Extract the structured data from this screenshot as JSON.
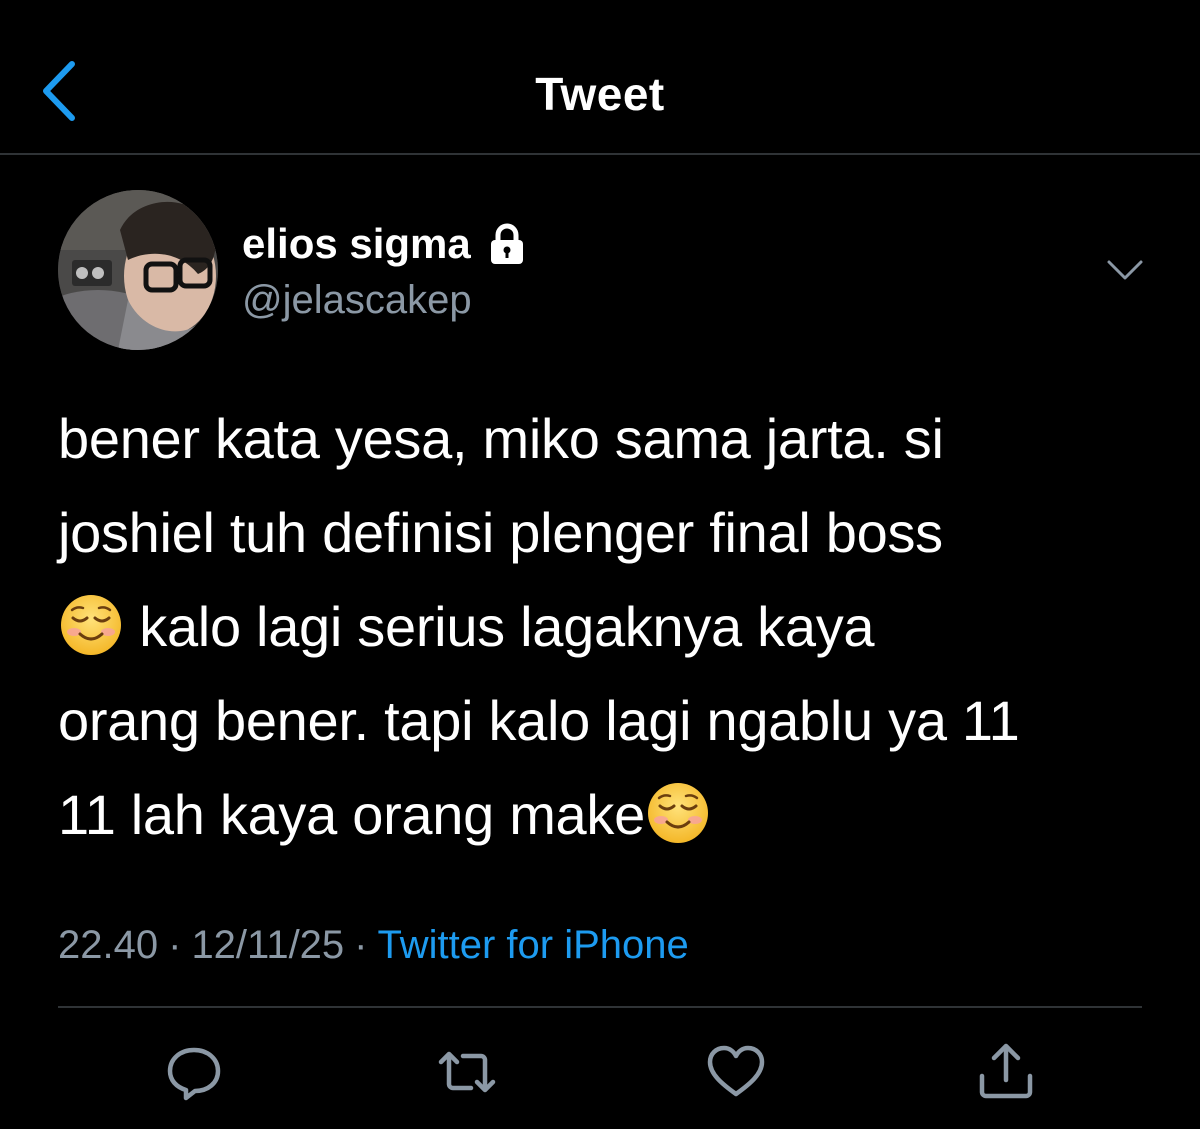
{
  "navbar": {
    "title": "Tweet",
    "back_icon": "chevron-left-icon",
    "accent_color": "#1d9bf0"
  },
  "author": {
    "display_name": "elios sigma",
    "handle": "@jelascakep",
    "protected_icon": "lock-icon",
    "menu_icon": "chevron-down-icon"
  },
  "tweet": {
    "lines": [
      "bener kata yesa, miko sama jarta. si",
      "joshiel tuh definisi plenger final boss",
      "kalo lagi serius lagaknya kaya",
      "orang bener. tapi kalo lagi ngablu ya 11",
      "11 lah kaya orang make"
    ],
    "emoji": "☺️",
    "emoji_name": "smiling-face-emoji"
  },
  "meta": {
    "time": "22.40",
    "separator": "·",
    "date": "12/11/25",
    "source": "Twitter for iPhone",
    "source_color": "#1d9bf0",
    "muted_color": "#8b98a5"
  },
  "actions": [
    {
      "name": "reply",
      "icon": "reply-icon"
    },
    {
      "name": "retweet",
      "icon": "retweet-icon"
    },
    {
      "name": "like",
      "icon": "heart-icon"
    },
    {
      "name": "share",
      "icon": "share-icon"
    }
  ],
  "colors": {
    "background": "#000000",
    "text": "#ffffff",
    "border": "#2f3336"
  }
}
